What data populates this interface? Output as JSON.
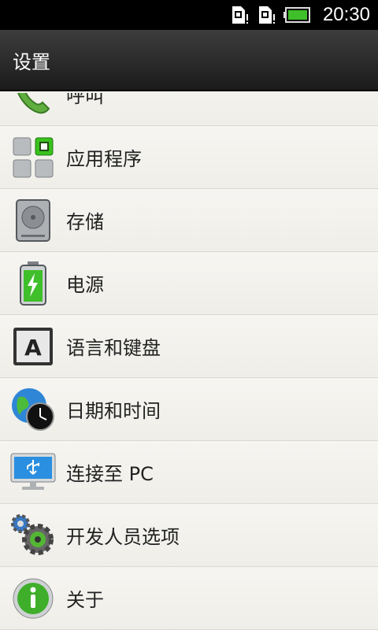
{
  "status_bar": {
    "time": "20:30",
    "icons": [
      "sim-card-alert-icon",
      "sim-card-alert-icon",
      "battery-icon"
    ]
  },
  "header": {
    "title": "设置"
  },
  "settings_list": {
    "items": [
      {
        "label": "呼叫",
        "icon": "phone-icon"
      },
      {
        "label": "应用程序",
        "icon": "applications-icon"
      },
      {
        "label": "存储",
        "icon": "storage-icon"
      },
      {
        "label": "电源",
        "icon": "power-battery-icon"
      },
      {
        "label": "语言和键盘",
        "icon": "keyboard-icon"
      },
      {
        "label": "日期和时间",
        "icon": "date-time-icon"
      },
      {
        "label": "连接至 PC",
        "icon": "usb-pc-icon"
      },
      {
        "label": "开发人员选项",
        "icon": "developer-gears-icon"
      },
      {
        "label": "关于",
        "icon": "about-info-icon"
      }
    ]
  },
  "colors": {
    "status_bar_bg": "#000000",
    "header_bg": "#2a2a2a",
    "list_bg": "#f3f2ee",
    "battery_green": "#3fbf2a"
  }
}
